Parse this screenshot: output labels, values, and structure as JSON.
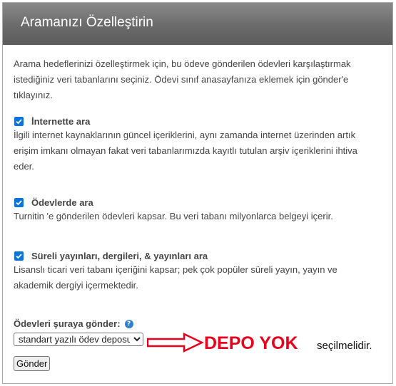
{
  "header": {
    "title": "Aramanızı Özelleştirin"
  },
  "intro": "Arama hedeflerinizi özelleştirmek için, bu ödeve gönderilen ödevleri karşılaştırmak istediğiniz veri tabanlarını seçiniz. Ödevi sınıf anasayfanıza eklemek için gönder'e tıklayınız.",
  "options": [
    {
      "label": "İnternette ara",
      "checked": true,
      "description": "İlgili internet kaynaklarının güncel içeriklerini, aynı zamanda internet üzerinden artık erişim imkanı olmayan fakat veri tabanlarımızda kayıtlı tutulan arşiv içeriklerini ihtiva eder."
    },
    {
      "label": "Ödevlerde ara",
      "checked": true,
      "description": "Turnitin 'e gönderilen ödevleri kapsar. Bu veri tabanı milyonlarca belgeyi içerir."
    },
    {
      "label": "Süreli yayınları, dergileri, & yayınları ara",
      "checked": true,
      "description": "Lisanslı ticari veri tabanı içeriğini kapsar; pek çok popüler süreli yayın, yayın ve akademik dergiyi içermektedir."
    }
  ],
  "send_to": {
    "label": "Ödevleri şuraya gönder:",
    "help_icon": "question-circle-icon",
    "selected": "standart yazılı ödev deposu"
  },
  "annotation": {
    "highlight": "DEPO YOK",
    "rest": "seçilmelidir.",
    "color": "#e8001c"
  },
  "submit_label": "Gönder"
}
